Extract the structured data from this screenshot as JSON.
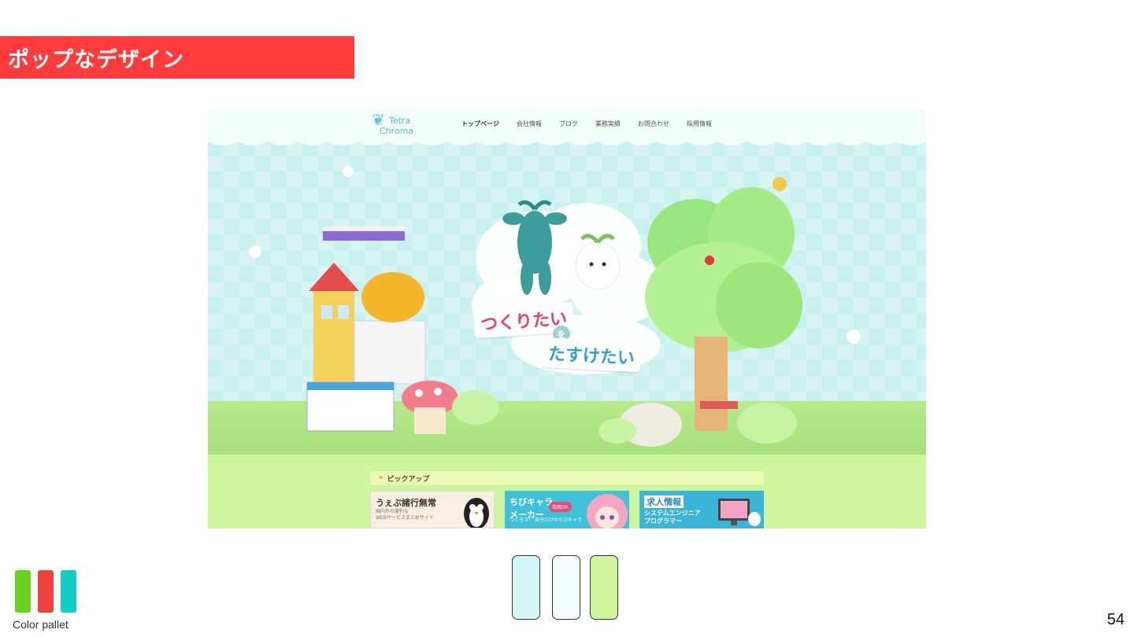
{
  "slide": {
    "title": "ポップなデザイン",
    "page_number": "54",
    "title_bar_color": "#ff3b3b"
  },
  "screenshot": {
    "logo_line1": "Tetra",
    "logo_line2": "Chroma",
    "nav": [
      "トップページ",
      "会社情報",
      "ブログ",
      "業務実績",
      "お問合わせ",
      "採用情報"
    ],
    "hero_line1": "つくりたい",
    "hero_connector": "を",
    "hero_line2": "たすけたい",
    "pickup_label": "ピックアップ",
    "cards": [
      {
        "title": "うぇぶ諸行無常",
        "sub1": "国内外の便利な",
        "sub2": "WEBサービスまとめサイト"
      },
      {
        "title": "ちびキャラ",
        "title2": "メーカー",
        "badge": "商用OK",
        "sub1": "つくろう！",
        "sub2": "自分だけのちびキャラ"
      },
      {
        "title": "求人情報",
        "sub1": "システムエンジニア",
        "sub2": "プログラマー"
      }
    ]
  },
  "color_pallet": {
    "caption": "Color pallet",
    "icon_colors": [
      "#6ad21f",
      "#f04040",
      "#10cfc7"
    ],
    "swatches": [
      "#d4f6f6",
      "#f3fbfc",
      "#cdf59d"
    ]
  }
}
